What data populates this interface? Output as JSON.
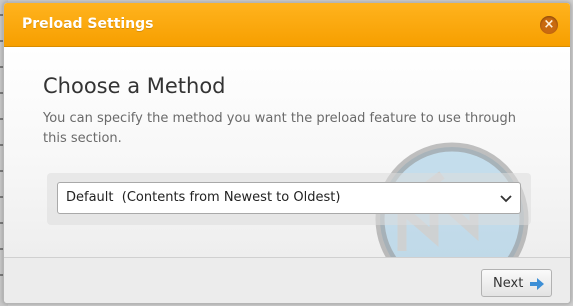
{
  "dialog": {
    "title": "Preload Settings",
    "close_icon": "close-icon",
    "accent_color": "#f7a000"
  },
  "content": {
    "heading": "Choose a Method",
    "description": "You can specify the method you want the preload feature to use through this section.",
    "method_select": {
      "selected": "Default  (Contents from Newest to Oldest)",
      "icon": "chevron-down-icon"
    },
    "watermark_icon": "fast-forward-icon"
  },
  "footer": {
    "next_label": "Next",
    "next_icon": "arrow-right-icon",
    "next_icon_color": "#3d8fd6"
  }
}
